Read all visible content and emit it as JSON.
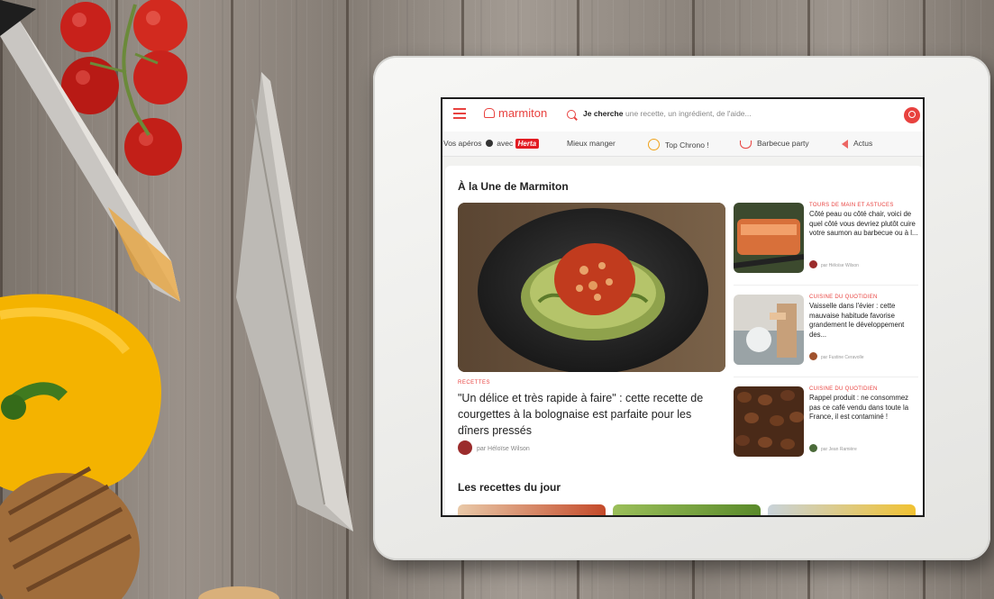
{
  "site": {
    "logo_text": "marmiton",
    "brand_color": "#e8423f"
  },
  "search": {
    "label": "Je cherche",
    "placeholder": "une recette, un ingrédient, de l'aide..."
  },
  "nav": {
    "items": [
      {
        "text_before": "Vos apéros",
        "text_mid": "avec",
        "badge": "Herta",
        "icon": "football-icon"
      },
      {
        "label": "Mieux manger"
      },
      {
        "label": "Top Chrono !",
        "icon": "stopwatch-icon"
      },
      {
        "label": "Barbecue party",
        "icon": "barbecue-icon"
      },
      {
        "label": "Actus",
        "icon": "megaphone-icon"
      }
    ]
  },
  "une": {
    "heading": "À la Une de Marmiton",
    "hero": {
      "tag": "RECETTES",
      "title": "\"Un délice et très rapide à faire\" : cette recette de courgettes à la bolognaise est parfaite pour les dîners pressés",
      "author": "par Héloïse Wilson"
    },
    "articles": [
      {
        "tag": "TOURS DE MAIN ET ASTUCES",
        "title": "Côté peau ou côté chair, voici de quel côté vous devriez plutôt cuire votre saumon au barbecue ou à l...",
        "author": "par Héloïse Wilson"
      },
      {
        "tag": "CUISINE DU QUOTIDIEN",
        "title": "Vaisselle dans l'évier : cette mauvaise habitude favorise grandement le développement des...",
        "author": "par Fustine Ceravolle"
      },
      {
        "tag": "CUISINE DU QUOTIDIEN",
        "title": "Rappel produit : ne consommez pas ce café vendu dans toute la France, il est contaminé !",
        "author": "par Jean Ramière"
      }
    ]
  },
  "recettes": {
    "heading": "Les recettes du jour"
  }
}
